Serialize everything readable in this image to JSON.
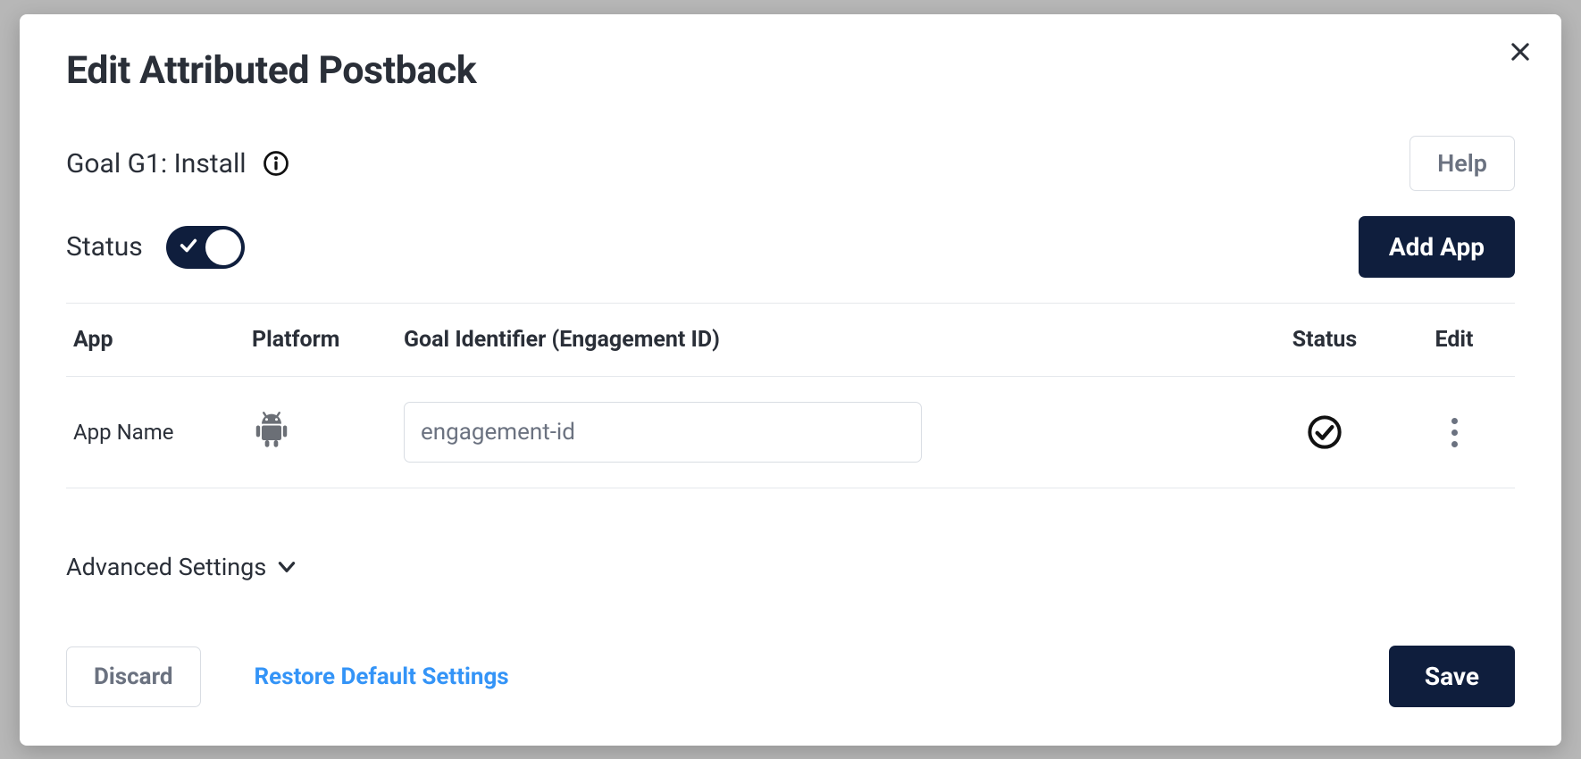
{
  "modal": {
    "title": "Edit Attributed Postback",
    "goal_label": "Goal G1: Install",
    "help_label": "Help",
    "status_label": "Status",
    "status_on": true,
    "add_app_label": "Add App",
    "advanced_label": "Advanced Settings"
  },
  "table": {
    "headers": {
      "app": "App",
      "platform": "Platform",
      "goal_id": "Goal Identifier (Engagement ID)",
      "status": "Status",
      "edit": "Edit"
    },
    "rows": [
      {
        "app_name": "App Name",
        "platform_icon": "android",
        "goal_input_value": "engagement-id",
        "status_checked": true
      }
    ]
  },
  "footer": {
    "discard": "Discard",
    "restore": "Restore Default Settings",
    "save": "Save"
  }
}
